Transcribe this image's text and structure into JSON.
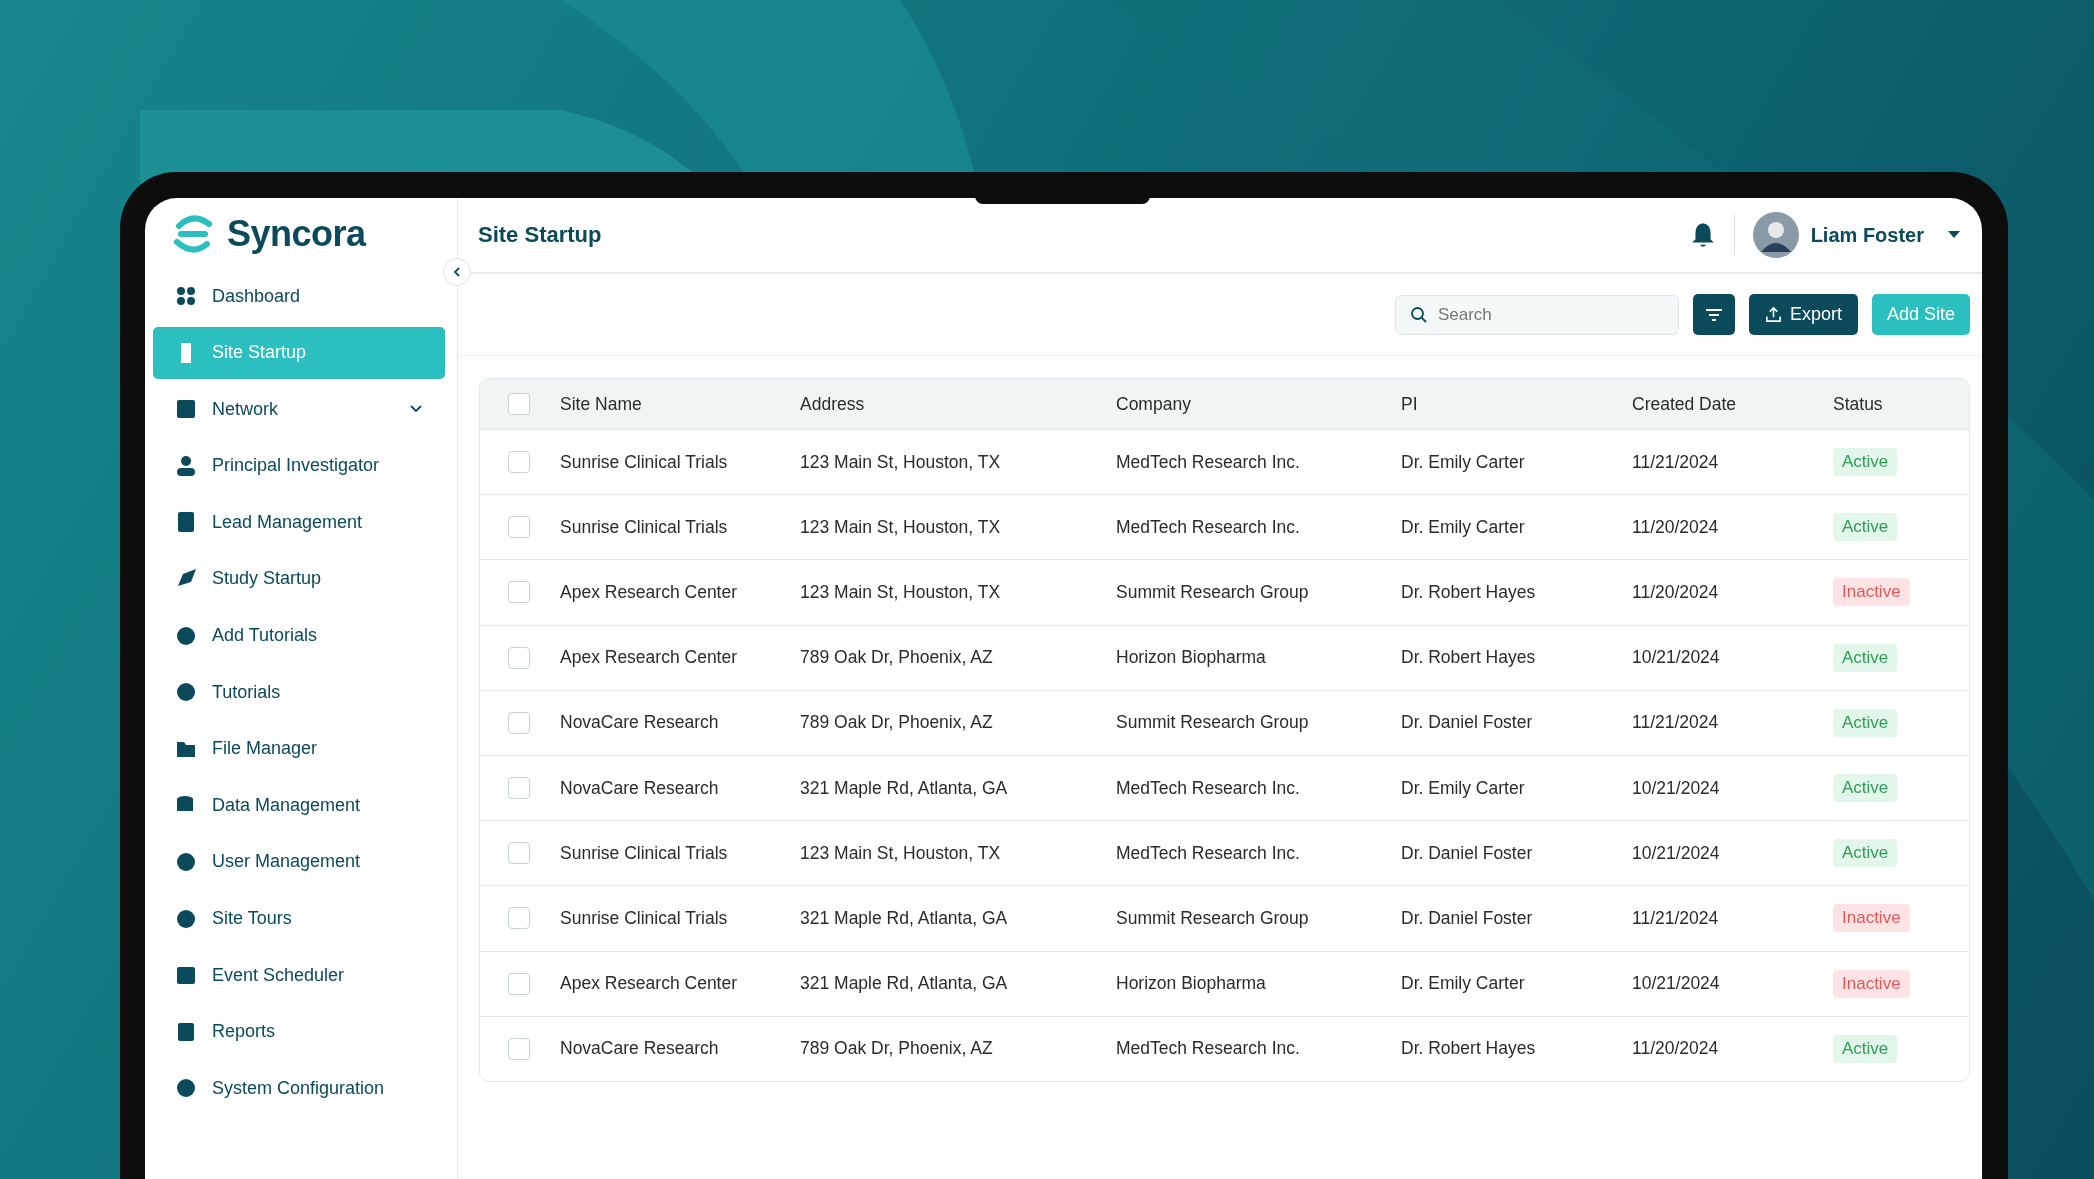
{
  "brand": {
    "name": "Syncora"
  },
  "sidebar": {
    "items": [
      {
        "label": "Dashboard",
        "selected": false
      },
      {
        "label": "Site Startup",
        "selected": true
      },
      {
        "label": "Network",
        "selected": false,
        "expandable": true
      },
      {
        "label": "Principal Investigator",
        "selected": false
      },
      {
        "label": "Lead Management",
        "selected": false
      },
      {
        "label": "Study Startup",
        "selected": false
      },
      {
        "label": "Add Tutorials",
        "selected": false
      },
      {
        "label": "Tutorials",
        "selected": false
      },
      {
        "label": "File Manager",
        "selected": false
      },
      {
        "label": "Data Management",
        "selected": false
      },
      {
        "label": "User Management",
        "selected": false
      },
      {
        "label": "Site Tours",
        "selected": false
      },
      {
        "label": "Event Scheduler",
        "selected": false
      },
      {
        "label": "Reports",
        "selected": false
      },
      {
        "label": "System Configuration",
        "selected": false
      }
    ]
  },
  "header": {
    "title": "Site Startup",
    "user": "Liam Foster"
  },
  "toolbar": {
    "search": {
      "placeholder": "Search"
    },
    "export": "Export",
    "add": "Add Site"
  },
  "table": {
    "select_all": {
      "checked": false
    },
    "columns": [
      "Site Name",
      "Address",
      "Company",
      "PI",
      "Created Date",
      "Status"
    ],
    "rows": [
      {
        "checked": false,
        "cells": [
          "Sunrise Clinical Trials",
          "123 Main St, Houston, TX",
          "MedTech Research Inc.",
          "Dr. Emily Carter",
          "11/21/2024"
        ],
        "status": "Active",
        "active": true
      },
      {
        "checked": false,
        "cells": [
          "Sunrise Clinical Trials",
          "123 Main St, Houston, TX",
          "MedTech Research Inc.",
          "Dr. Emily Carter",
          "11/20/2024"
        ],
        "status": "Active",
        "active": true
      },
      {
        "checked": false,
        "cells": [
          "Apex Research Center",
          "123 Main St, Houston, TX",
          "Summit Research Group",
          "Dr. Robert Hayes",
          "11/20/2024"
        ],
        "status": "Inactive",
        "active": false
      },
      {
        "checked": false,
        "cells": [
          "Apex Research Center",
          "789 Oak Dr, Phoenix, AZ",
          "Horizon Biopharma",
          "Dr. Robert Hayes",
          "10/21/2024"
        ],
        "status": "Active",
        "active": true
      },
      {
        "checked": false,
        "cells": [
          "NovaCare Research",
          "789 Oak Dr, Phoenix, AZ",
          "Summit Research Group",
          "Dr. Daniel Foster",
          "11/21/2024"
        ],
        "status": "Active",
        "active": true
      },
      {
        "checked": false,
        "cells": [
          "NovaCare Research",
          "321 Maple Rd, Atlanta, GA",
          "MedTech Research Inc.",
          "Dr. Emily Carter",
          "10/21/2024"
        ],
        "status": "Active",
        "active": true
      },
      {
        "checked": false,
        "cells": [
          "Sunrise Clinical Trials",
          "123 Main St, Houston, TX",
          "MedTech Research Inc.",
          "Dr. Daniel Foster",
          "10/21/2024"
        ],
        "status": "Active",
        "active": true
      },
      {
        "checked": false,
        "cells": [
          "Sunrise Clinical Trials",
          "321 Maple Rd, Atlanta, GA",
          "Summit Research Group",
          "Dr. Daniel Foster",
          "11/21/2024"
        ],
        "status": "Inactive",
        "active": false
      },
      {
        "checked": false,
        "cells": [
          "Apex Research Center",
          "321 Maple Rd, Atlanta, GA",
          "Horizon Biopharma",
          "Dr. Emily Carter",
          "10/21/2024"
        ],
        "status": "Inactive",
        "active": false
      },
      {
        "checked": false,
        "cells": [
          "NovaCare Research",
          "789 Oak Dr, Phoenix, AZ",
          "MedTech Research Inc.",
          "Dr. Robert Hayes",
          "11/20/2024"
        ],
        "status": "Active",
        "active": true
      }
    ]
  }
}
